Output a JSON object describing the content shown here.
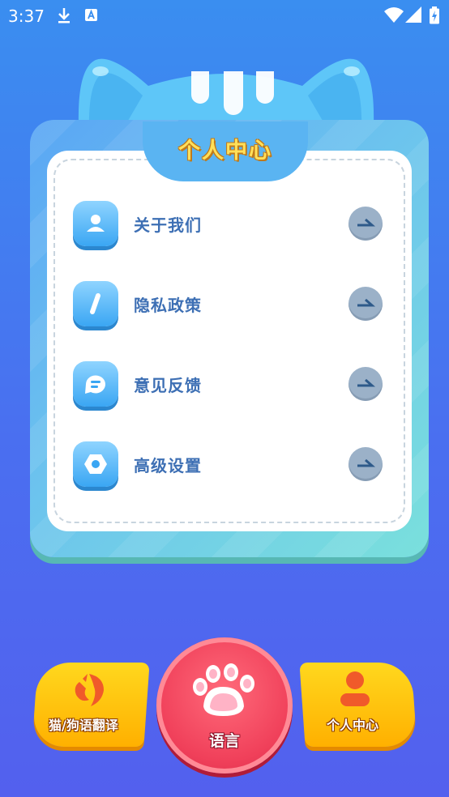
{
  "status_bar": {
    "time": "3:37",
    "icons": [
      "download-icon",
      "a11y-icon",
      "wifi-icon",
      "signal-icon",
      "battery-icon"
    ]
  },
  "header": {
    "title": "个人中心"
  },
  "menu": {
    "items": [
      {
        "label": "关于我们",
        "icon": "user-icon"
      },
      {
        "label": "隐私政策",
        "icon": "info-icon"
      },
      {
        "label": "意见反馈",
        "icon": "chat-icon"
      },
      {
        "label": "高级设置",
        "icon": "settings-icon"
      }
    ]
  },
  "bottom_nav": {
    "translate_label": "猫/狗语翻译",
    "language_label": "语言",
    "profile_label": "个人中心"
  },
  "colors": {
    "background": "#3a8ef0",
    "panel": "#6cc3ee",
    "label_text": "#3d6fb4",
    "title_text": "#ffe05a",
    "nav_yellow": "#ffd81e",
    "nav_red": "#f0405a",
    "arrow_button": "#9bb1c8"
  }
}
